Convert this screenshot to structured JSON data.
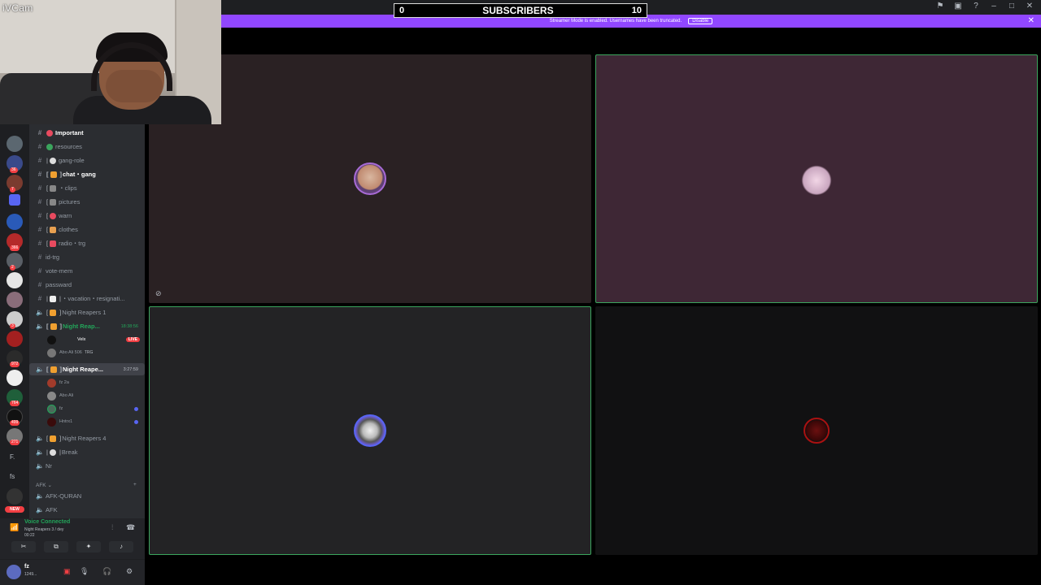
{
  "webcam": {
    "label": "iVCam"
  },
  "subscribers": {
    "left": "0",
    "title": "SUBSCRIBERS",
    "right": "10"
  },
  "streamer_banner": {
    "text": "Streamer Mode is enabled. Usernames have been truncated.",
    "button": "Disable"
  },
  "rail": {
    "badges": [
      "36",
      "7",
      "366",
      "2",
      "3",
      "972",
      "764",
      "499",
      "271"
    ],
    "letters": [
      "F.",
      "fs"
    ],
    "new_label": "NEW"
  },
  "channels": {
    "text": [
      {
        "name": "Important",
        "active": true
      },
      {
        "name": "resources"
      },
      {
        "name": "gang-role"
      },
      {
        "name": "chat・gang",
        "active": true
      },
      {
        "name": "・clips"
      },
      {
        "name": "pictures"
      },
      {
        "name": "warn"
      },
      {
        "name": "clothes"
      },
      {
        "name": "radio・trg"
      },
      {
        "name": "id-trg"
      },
      {
        "name": "vote-mem"
      },
      {
        "name": "passward"
      },
      {
        "name": "・vacation・resignati..."
      }
    ],
    "voice": [
      {
        "name": "Night Reapers 1"
      },
      {
        "name": "Night Reap...",
        "timer": "18:38:56"
      },
      {
        "name": "Night Reape...",
        "timer": "3:27:59"
      },
      {
        "name": "Night Reapers 4"
      },
      {
        "name": "Break"
      },
      {
        "name": "Nr"
      }
    ],
    "users_room2": [
      {
        "name": "Velx",
        "live": "LIVE"
      },
      {
        "name": "Abo Ali 506",
        "tag": "TRG"
      }
    ],
    "users_room3": [
      {
        "name": "fz 2a"
      },
      {
        "name": "Abo Ali"
      },
      {
        "name": "fz"
      },
      {
        "name": "Hntrx1"
      }
    ],
    "category": "AFK",
    "afk": [
      {
        "name": "AFK-QURAN"
      },
      {
        "name": "AFK"
      }
    ]
  },
  "voice_panel": {
    "status": "Voice Connected",
    "channel": "Night Reapers 3 / dey",
    "time": "00:22"
  },
  "user_panel": {
    "name": "fz",
    "status": "1249..."
  }
}
